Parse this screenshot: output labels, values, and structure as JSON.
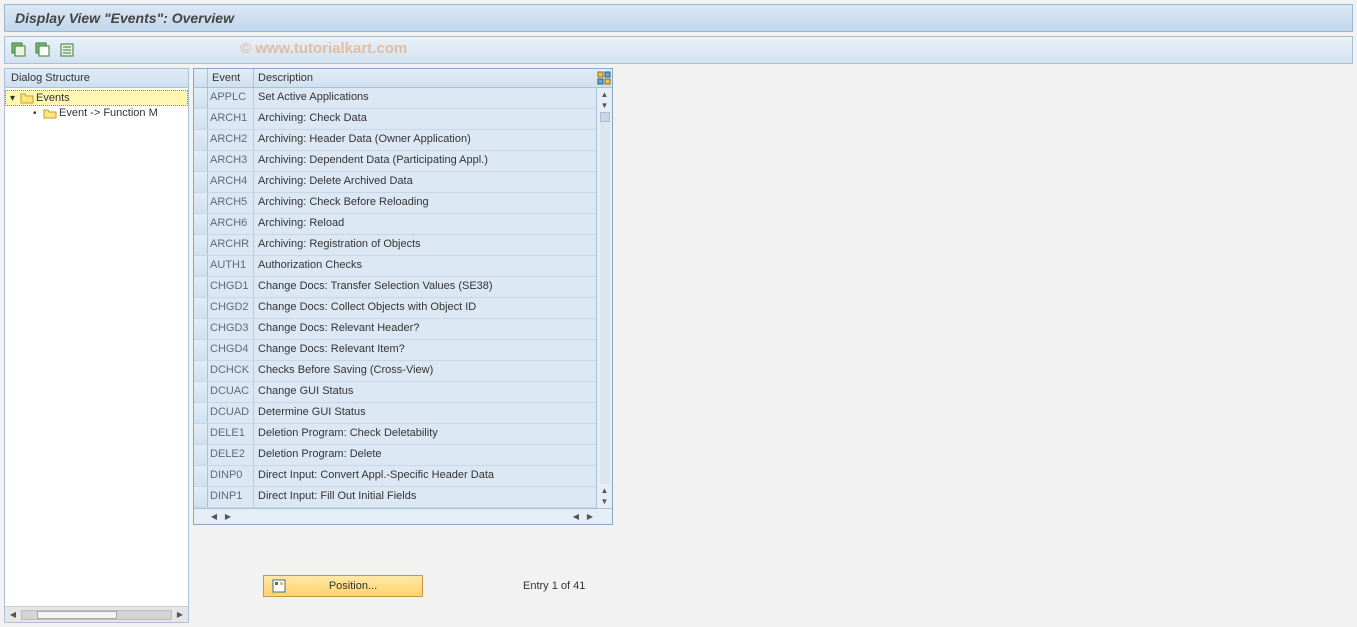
{
  "title": "Display View \"Events\": Overview",
  "watermark": "© www.tutorialkart.com",
  "tree": {
    "header": "Dialog Structure",
    "root": {
      "label": "Events",
      "expanded": true
    },
    "child": {
      "label": "Event -> Function M"
    }
  },
  "table": {
    "col_event": "Event",
    "col_desc": "Description",
    "rows": [
      {
        "event": "APPLC",
        "desc": "Set Active Applications"
      },
      {
        "event": "ARCH1",
        "desc": "Archiving: Check Data"
      },
      {
        "event": "ARCH2",
        "desc": "Archiving: Header Data (Owner Application)"
      },
      {
        "event": "ARCH3",
        "desc": "Archiving: Dependent Data (Participating Appl.)"
      },
      {
        "event": "ARCH4",
        "desc": "Archiving: Delete Archived Data"
      },
      {
        "event": "ARCH5",
        "desc": "Archiving: Check Before Reloading"
      },
      {
        "event": "ARCH6",
        "desc": "Archiving: Reload"
      },
      {
        "event": "ARCHR",
        "desc": "Archiving: Registration of Objects"
      },
      {
        "event": "AUTH1",
        "desc": "Authorization Checks"
      },
      {
        "event": "CHGD1",
        "desc": "Change Docs: Transfer Selection Values (SE38)"
      },
      {
        "event": "CHGD2",
        "desc": "Change Docs: Collect Objects with Object ID"
      },
      {
        "event": "CHGD3",
        "desc": "Change Docs: Relevant Header?"
      },
      {
        "event": "CHGD4",
        "desc": "Change Docs: Relevant Item?"
      },
      {
        "event": "DCHCK",
        "desc": "Checks Before Saving (Cross-View)"
      },
      {
        "event": "DCUAC",
        "desc": "Change GUI Status"
      },
      {
        "event": "DCUAD",
        "desc": "Determine GUI Status"
      },
      {
        "event": "DELE1",
        "desc": "Deletion Program: Check Deletability"
      },
      {
        "event": "DELE2",
        "desc": "Deletion Program: Delete"
      },
      {
        "event": "DINP0",
        "desc": "Direct Input: Convert Appl.-Specific Header Data"
      },
      {
        "event": "DINP1",
        "desc": "Direct Input: Fill Out Initial Fields"
      }
    ]
  },
  "footer": {
    "position_label": "Position...",
    "entry_text": "Entry 1 of 41"
  }
}
